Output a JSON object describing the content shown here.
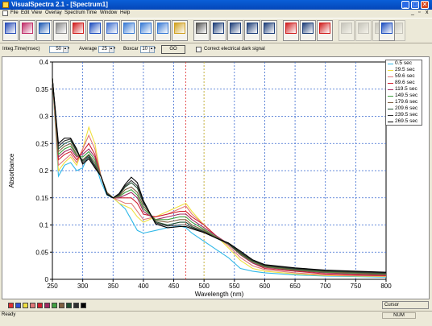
{
  "window": {
    "title": "VisualSpectra 2.1 - [Spectrum1]",
    "controls": {
      "minimize": "_",
      "maximize": "□",
      "close": "✕"
    }
  },
  "menu": {
    "items": [
      "File",
      "Edit",
      "View",
      "Overlay",
      "Spectrum",
      "Time",
      "Window",
      "Help"
    ],
    "mdi_controls": [
      "_",
      "▫",
      "x"
    ]
  },
  "toolbar": {
    "buttons": [
      {
        "icon": "spectrum-bars-icon",
        "caption": "",
        "color": "#2b4fb8"
      },
      {
        "icon": "rainbow-bars-icon",
        "caption": "",
        "color": "#c0306a"
      },
      {
        "icon": "globe-icon",
        "caption": "",
        "color": "#1e5ab4"
      },
      {
        "icon": "wrench-icon",
        "caption": "",
        "color": "#888888"
      },
      {
        "icon": "record-icon",
        "caption": "",
        "color": "#d02020"
      },
      {
        "icon": "peaks-icon",
        "caption": "",
        "color": "#2050c0"
      },
      {
        "icon": "zoom-icon",
        "caption": "",
        "color": "#4070d0"
      },
      {
        "icon": "chart-icon",
        "caption": "",
        "color": "#3a7bd5"
      },
      {
        "icon": "grid-icon",
        "caption": "",
        "color": "#3a7bd5"
      },
      {
        "icon": "line-chart-icon",
        "caption": "",
        "color": "#3a7bd5"
      },
      {
        "icon": "magnifier-icon",
        "caption": "",
        "color": "#d0a020"
      },
      {
        "icon": "check-icon",
        "caption": "",
        "color": "#555555"
      },
      {
        "icon": "cursor-icon",
        "caption": "",
        "color": "#20407a"
      },
      {
        "icon": "cursor2-icon",
        "caption": "",
        "color": "#20407a"
      },
      {
        "icon": "peak-find-icon",
        "caption": "",
        "color": "#20407a"
      },
      {
        "icon": "palette-icon",
        "caption": "",
        "color": "#20407a"
      },
      {
        "icon": "expand-y-icon",
        "caption": "",
        "color": "#d02020"
      },
      {
        "icon": "scale-icon",
        "caption": "",
        "color": "#20407a"
      },
      {
        "icon": "target-icon",
        "caption": "",
        "color": "#d02020"
      },
      {
        "icon": "tools-icon",
        "caption": "",
        "color": "#999999",
        "disabled": true
      },
      {
        "icon": "folder-icon",
        "caption": "",
        "color": "#999999",
        "disabled": true
      },
      {
        "icon": "export-icon",
        "caption": "",
        "color": "#999999",
        "disabled": true
      },
      {
        "icon": "save-icon",
        "caption": "",
        "color": "#999999",
        "disabled": true
      },
      {
        "icon": "disk-icon",
        "caption": "",
        "color": "#2050c0"
      }
    ]
  },
  "params": {
    "integ_time_label": "Integ.Time(msec)",
    "integ_time_value": "50",
    "average_label": "Average",
    "average_value": "25",
    "boxcar_label": "Boxcar",
    "boxcar_value": "10",
    "go_label": "GO",
    "correct_dark_label": "Correct electrical dark signal"
  },
  "chart_data": {
    "type": "line",
    "xlabel": "Wavelength (nm)",
    "ylabel": "Absorbance",
    "xlim": [
      250,
      800
    ],
    "ylim": [
      0,
      0.4
    ],
    "xticks": [
      250,
      300,
      350,
      400,
      450,
      500,
      550,
      600,
      650,
      700,
      750,
      800
    ],
    "yticks": [
      0,
      0.05,
      0.1,
      0.15,
      0.2,
      0.25,
      0.3,
      0.35,
      0.4
    ],
    "ytick_labels": [
      "0",
      "0.05",
      "0.1",
      "0.15",
      "0.2",
      "0.25",
      "0.3",
      "0.35",
      "0.4"
    ],
    "grid": "dotted-blue",
    "legend_placement": "top-right",
    "markers": [
      {
        "x": 470,
        "color": "#e03030"
      },
      {
        "x": 500,
        "color": "#e0c020"
      }
    ],
    "x": [
      250,
      260,
      270,
      280,
      290,
      300,
      310,
      320,
      330,
      340,
      350,
      360,
      370,
      380,
      390,
      400,
      420,
      440,
      460,
      470,
      480,
      500,
      520,
      540,
      560,
      580,
      600,
      650,
      700,
      750,
      800
    ],
    "series": [
      {
        "name": "0.5 sec",
        "color": "#30b8e8",
        "values": [
          0.37,
          0.19,
          0.21,
          0.215,
          0.2,
          0.205,
          0.23,
          0.215,
          0.18,
          0.155,
          0.15,
          0.14,
          0.13,
          0.11,
          0.09,
          0.085,
          0.09,
          0.095,
          0.098,
          0.095,
          0.085,
          0.07,
          0.055,
          0.04,
          0.02,
          0.015,
          0.012,
          0.008,
          0.006,
          0.005,
          0.004
        ]
      },
      {
        "name": "29.5 sec",
        "color": "#f0e040",
        "values": [
          0.37,
          0.2,
          0.215,
          0.225,
          0.21,
          0.24,
          0.28,
          0.25,
          0.19,
          0.16,
          0.15,
          0.14,
          0.135,
          0.13,
          0.115,
          0.105,
          0.115,
          0.125,
          0.135,
          0.14,
          0.125,
          0.1,
          0.08,
          0.058,
          0.035,
          0.02,
          0.015,
          0.01,
          0.007,
          0.006,
          0.005
        ]
      },
      {
        "name": "59.6 sec",
        "color": "#e07878",
        "values": [
          0.37,
          0.21,
          0.22,
          0.23,
          0.215,
          0.24,
          0.265,
          0.24,
          0.19,
          0.16,
          0.15,
          0.145,
          0.14,
          0.14,
          0.125,
          0.11,
          0.115,
          0.12,
          0.13,
          0.135,
          0.12,
          0.1,
          0.08,
          0.062,
          0.04,
          0.025,
          0.018,
          0.012,
          0.008,
          0.007,
          0.006
        ]
      },
      {
        "name": "89.6 sec",
        "color": "#d02030",
        "values": [
          0.37,
          0.22,
          0.23,
          0.235,
          0.22,
          0.235,
          0.25,
          0.23,
          0.19,
          0.16,
          0.15,
          0.15,
          0.15,
          0.15,
          0.14,
          0.12,
          0.115,
          0.12,
          0.125,
          0.125,
          0.115,
          0.1,
          0.08,
          0.065,
          0.045,
          0.03,
          0.02,
          0.015,
          0.01,
          0.008,
          0.007
        ]
      },
      {
        "name": "119.5 sec",
        "color": "#a02860",
        "values": [
          0.37,
          0.225,
          0.235,
          0.24,
          0.225,
          0.23,
          0.24,
          0.225,
          0.19,
          0.16,
          0.15,
          0.15,
          0.155,
          0.16,
          0.15,
          0.125,
          0.11,
          0.115,
          0.12,
          0.12,
          0.11,
          0.095,
          0.08,
          0.065,
          0.045,
          0.03,
          0.022,
          0.016,
          0.012,
          0.01,
          0.008
        ]
      },
      {
        "name": "149.5 sec",
        "color": "#40a040",
        "values": [
          0.37,
          0.23,
          0.24,
          0.245,
          0.228,
          0.225,
          0.235,
          0.22,
          0.19,
          0.16,
          0.15,
          0.152,
          0.16,
          0.165,
          0.155,
          0.13,
          0.11,
          0.11,
          0.115,
          0.115,
          0.105,
          0.092,
          0.078,
          0.065,
          0.046,
          0.032,
          0.023,
          0.017,
          0.013,
          0.011,
          0.009
        ]
      },
      {
        "name": "179.6 sec",
        "color": "#806040",
        "values": [
          0.37,
          0.235,
          0.245,
          0.25,
          0.23,
          0.22,
          0.23,
          0.215,
          0.19,
          0.16,
          0.15,
          0.153,
          0.165,
          0.17,
          0.16,
          0.135,
          0.108,
          0.105,
          0.11,
          0.11,
          0.1,
          0.09,
          0.077,
          0.065,
          0.047,
          0.033,
          0.024,
          0.018,
          0.014,
          0.012,
          0.01
        ]
      },
      {
        "name": "209.6 sec",
        "color": "#205030",
        "values": [
          0.37,
          0.24,
          0.25,
          0.255,
          0.235,
          0.218,
          0.228,
          0.21,
          0.19,
          0.158,
          0.15,
          0.155,
          0.17,
          0.178,
          0.168,
          0.14,
          0.106,
          0.1,
          0.105,
          0.105,
          0.097,
          0.088,
          0.076,
          0.065,
          0.048,
          0.034,
          0.025,
          0.019,
          0.015,
          0.013,
          0.011
        ]
      },
      {
        "name": "239.5 sec",
        "color": "#303030",
        "values": [
          0.37,
          0.245,
          0.255,
          0.258,
          0.238,
          0.215,
          0.225,
          0.208,
          0.19,
          0.157,
          0.15,
          0.156,
          0.172,
          0.182,
          0.172,
          0.142,
          0.104,
          0.098,
          0.1,
          0.1,
          0.095,
          0.087,
          0.076,
          0.066,
          0.05,
          0.035,
          0.026,
          0.02,
          0.016,
          0.014,
          0.012
        ]
      },
      {
        "name": "269.5 sec",
        "color": "#000000",
        "values": [
          0.37,
          0.25,
          0.26,
          0.26,
          0.24,
          0.212,
          0.222,
          0.205,
          0.19,
          0.156,
          0.15,
          0.158,
          0.175,
          0.188,
          0.178,
          0.145,
          0.102,
          0.095,
          0.097,
          0.097,
          0.093,
          0.086,
          0.076,
          0.067,
          0.052,
          0.036,
          0.027,
          0.021,
          0.017,
          0.015,
          0.013
        ]
      }
    ]
  },
  "palette": {
    "swatches": [
      "#e03030",
      "#3050d0",
      "#f0e040",
      "#e07878",
      "#d02030",
      "#a02860",
      "#40a040",
      "#806040",
      "#205030",
      "#303030",
      "#000000"
    ]
  },
  "status": {
    "ready": "Ready",
    "cursor_label": "Cursor",
    "num": "NUM"
  }
}
